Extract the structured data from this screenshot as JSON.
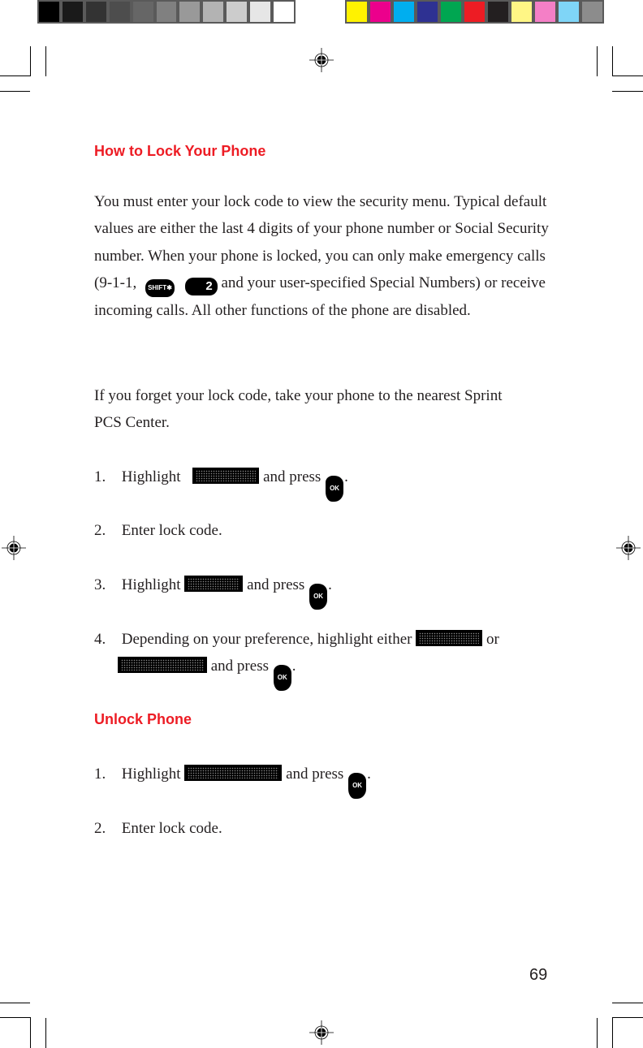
{
  "print_marks": {
    "gray_swatches": [
      "#000000",
      "#1a1a1a",
      "#333333",
      "#4d4d4d",
      "#666666",
      "#808080",
      "#999999",
      "#b3b3b3",
      "#cccccc",
      "#e6e6e6",
      "#ffffff"
    ],
    "color_swatches": [
      "#fff200",
      "#ec008c",
      "#00aeef",
      "#2e3192",
      "#00a651",
      "#ed1c24",
      "#231f20",
      "#fff685",
      "#f47fc6",
      "#7fd5f7",
      "#8c8c8c"
    ]
  },
  "colors": {
    "heading": "#ed1c24",
    "text": "#231f20"
  },
  "section1": {
    "title": "How to Lock Your Phone",
    "intro": "You must enter your lock code to view the security menu. Typical default values are either the last 4 digits of your phone number or Social Security number. When your phone is locked, you can only make emergency calls (9-1-1,",
    "keys": {
      "shift_star": "SHIFT✱",
      "two": "2"
    },
    "intro_cont": "and your user-specified Special Numbers) or receive incoming calls. All other functions of the phone are disabled.",
    "forget": "If you forget your lock code, take your phone to the nearest Sprint PCS Center.",
    "steps": [
      {
        "num": "1.",
        "pre": "Highlight",
        "lcd": "Security",
        "mid": "and press",
        "key": "OK",
        "end": "."
      },
      {
        "num": "2.",
        "text": "Enter lock code."
      },
      {
        "num": "3.",
        "pre": "Highlight",
        "lcd": "Lock Phone",
        "mid": "and press",
        "key": "OK",
        "end": "."
      },
      {
        "num": "4.",
        "pre": "Depending on your preference, highlight either",
        "lcd": "Lock Now",
        "or": "or",
        "lcd2": "On Power-Up",
        "mid": "and press",
        "key": "OK",
        "end": "."
      }
    ]
  },
  "section2": {
    "title": "Unlock Phone",
    "steps": [
      {
        "num": "1.",
        "pre": "Highlight",
        "lcd": "Unlock Phone",
        "mid": "and press",
        "key": "OK",
        "end": "."
      },
      {
        "num": "2.",
        "text": "Enter lock code."
      }
    ]
  },
  "page_number": "69"
}
